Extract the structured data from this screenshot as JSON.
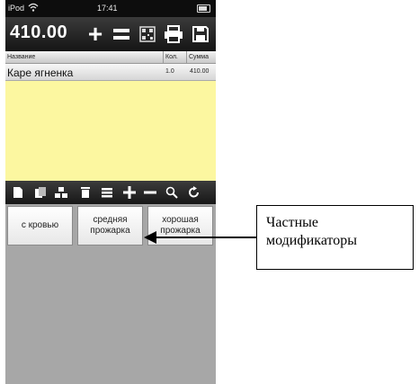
{
  "statusbar": {
    "carrier": "iPod",
    "time": "17:41"
  },
  "toolbar": {
    "total": "410.00",
    "buttons": [
      "plus-icon",
      "equals-icon",
      "qr-code-icon",
      "printer-icon",
      "save-icon"
    ]
  },
  "columns": {
    "name": "Название",
    "qty": "Кол.",
    "sum": "Сумма"
  },
  "order": {
    "items": [
      {
        "name": "Каре ягненка",
        "qty": "1.0",
        "sum": "410.00"
      }
    ]
  },
  "actionbar": {
    "buttons": [
      "document-icon",
      "copy-icon",
      "split-icon",
      "trash-icon",
      "list-icon",
      "plus-icon",
      "minus-icon",
      "search-icon",
      "refresh-icon"
    ]
  },
  "modifiers": [
    {
      "label": "с кровью"
    },
    {
      "label": "средняя\nпрожарка"
    },
    {
      "label": "хорошая\nпрожарка"
    }
  ],
  "annotation": {
    "text": "Частные\nмодификаторы"
  },
  "colors": {
    "list_background": "#fcf7a0",
    "toolbar": "#1e1e1e",
    "panel": "#a7a7a7"
  }
}
